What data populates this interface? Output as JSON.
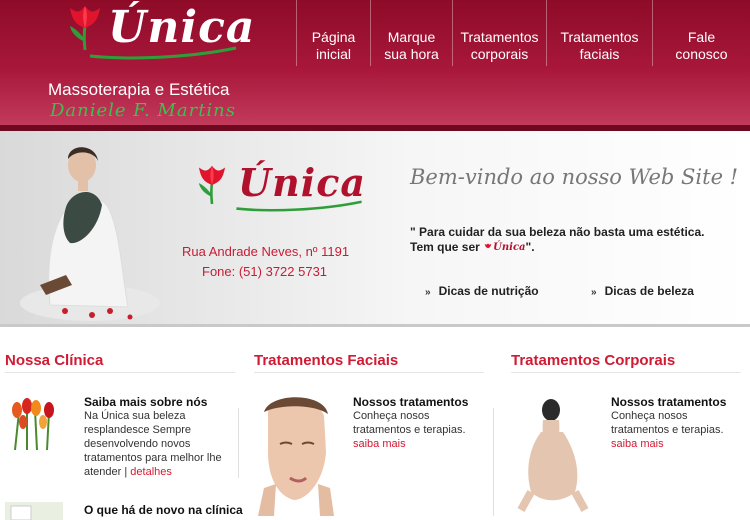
{
  "brand": {
    "logo_text": "Única",
    "tagline": "Massoterapia e Estética",
    "owner": "Daniele F. Martins"
  },
  "nav": [
    {
      "line1": "Página",
      "line2": "inicial"
    },
    {
      "line1": "Marque",
      "line2": "sua hora"
    },
    {
      "line1": "Tratamentos",
      "line2": "corporais"
    },
    {
      "line1": "Tratamentos",
      "line2": "faciais"
    },
    {
      "line1": "Fale",
      "line2": "conosco"
    }
  ],
  "banner": {
    "logo_text": "Única",
    "address": "Rua Andrade Neves, nº 1191",
    "phone": "Fone: (51) 3722 5731",
    "welcome": "Bem-vindo ao nosso Web Site !",
    "quote_line1": "\" Para cuidar da sua beleza não basta uma estética.",
    "quote_line2_prefix": "Tem que ser",
    "quote_logo": "Única",
    "quote_line2_suffix": "\".",
    "links": [
      "Dicas de nutrição",
      "Dicas de beleza"
    ]
  },
  "columns": {
    "clinic": {
      "title": "Nossa Clínica",
      "item1_title": "Saiba mais sobre nós",
      "item1_text": "Na Única sua beleza resplandesce Sempre desenvolvendo novos tratamentos para melhor lhe atender |",
      "item1_link": "detalhes",
      "item2_title": "O que há de novo na clínica"
    },
    "facial": {
      "title": "Tratamentos Faciais",
      "item_title": "Nossos tratamentos",
      "item_text": "Conheça nosos tratamentos e terapias.",
      "item_link": "saiba mais"
    },
    "body": {
      "title": "Tratamentos Corporais",
      "item_title": "Nossos tratamentos",
      "item_text": "Conheça nosos tratamentos e terapias.",
      "item_link": "saiba mais"
    }
  },
  "colors": {
    "brand_red": "#a8173a",
    "accent_red": "#d11a33",
    "owner_green": "#3fbf4f"
  }
}
